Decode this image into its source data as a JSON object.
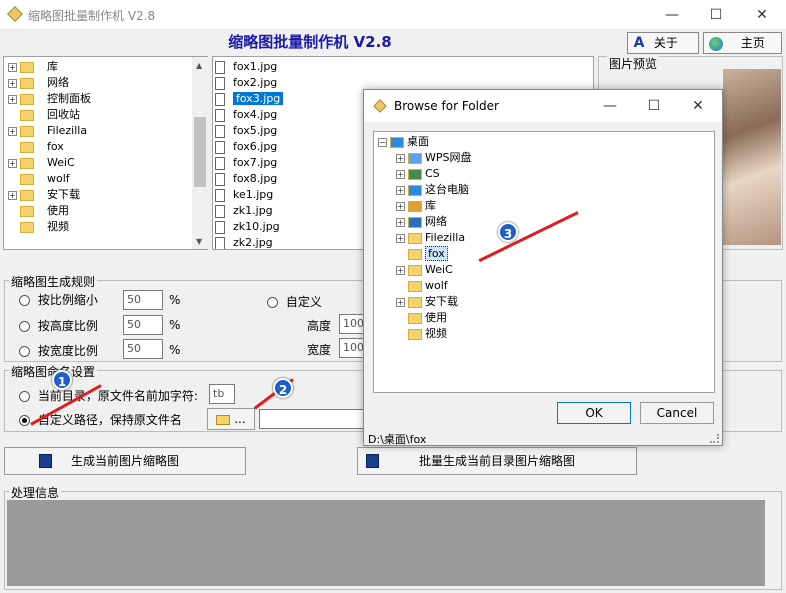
{
  "window": {
    "title": "缩略图批量制作机 V2.8",
    "minimize": "—",
    "maximize": "☐",
    "close": "✕"
  },
  "header": {
    "title": "缩略图批量制作机 V2.8",
    "about_label": "关于",
    "home_label": "主页"
  },
  "folder_tree": [
    {
      "label": "库",
      "expander": "+"
    },
    {
      "label": "网络",
      "expander": "+"
    },
    {
      "label": "控制面板",
      "expander": "+"
    },
    {
      "label": "回收站",
      "expander": ""
    },
    {
      "label": "Filezilla",
      "expander": "+"
    },
    {
      "label": "fox",
      "expander": ""
    },
    {
      "label": "WeiC",
      "expander": "+"
    },
    {
      "label": "wolf",
      "expander": ""
    },
    {
      "label": "安下载",
      "expander": "+"
    },
    {
      "label": "使用",
      "expander": ""
    },
    {
      "label": "视频",
      "expander": ""
    }
  ],
  "file_list": {
    "items": [
      "fox1.jpg",
      "fox2.jpg",
      "fox3.jpg",
      "fox4.jpg",
      "fox5.jpg",
      "fox6.jpg",
      "fox7.jpg",
      "fox8.jpg",
      "ke1.jpg",
      "zk1.jpg",
      "zk10.jpg",
      "zk2.jpg"
    ],
    "selected_index": 2
  },
  "preview": {
    "label": "图片预览"
  },
  "rules": {
    "legend": "缩略图生成规则",
    "options": [
      {
        "label": "按比例缩小",
        "value": "50",
        "unit": "%"
      },
      {
        "label": "按高度比例",
        "value": "50",
        "unit": "%"
      },
      {
        "label": "按宽度比例",
        "value": "50",
        "unit": "%"
      }
    ],
    "custom_label": "自定义",
    "height_label": "高度",
    "height_value": "100",
    "width_label": "宽度",
    "width_value": "100"
  },
  "naming": {
    "legend": "缩略图命名设置",
    "option1_label": "当前目录，原文件名前加字符:",
    "prefix_value": "tb",
    "option2_label": "自定义路径，保持原文件名",
    "browse_label": "...",
    "path_value": ""
  },
  "actions": {
    "generate_current": "生成当前图片缩略图",
    "batch_generate": "批量生成当前目录图片缩略图"
  },
  "log": {
    "legend": "处理信息"
  },
  "dialog": {
    "title": "Browse for Folder",
    "tree": [
      {
        "label": "桌面",
        "expander": "−",
        "level": 0,
        "icon": "monitor-icon"
      },
      {
        "label": "WPS网盘",
        "expander": "+",
        "level": 1,
        "icon": "cloud-icon"
      },
      {
        "label": "CS",
        "expander": "+",
        "level": 1,
        "icon": "user-icon"
      },
      {
        "label": "这台电脑",
        "expander": "+",
        "level": 1,
        "icon": "computer-icon"
      },
      {
        "label": "库",
        "expander": "+",
        "level": 1,
        "icon": "library-icon"
      },
      {
        "label": "网络",
        "expander": "+",
        "level": 1,
        "icon": "network-icon"
      },
      {
        "label": "Filezilla",
        "expander": "+",
        "level": 1,
        "icon": "folder-icon"
      },
      {
        "label": "fox",
        "expander": "",
        "level": 1,
        "icon": "folder-icon"
      },
      {
        "label": "WeiC",
        "expander": "+",
        "level": 1,
        "icon": "folder-icon"
      },
      {
        "label": "wolf",
        "expander": "",
        "level": 1,
        "icon": "folder-icon"
      },
      {
        "label": "安下载",
        "expander": "+",
        "level": 1,
        "icon": "folder-icon"
      },
      {
        "label": "使用",
        "expander": "",
        "level": 1,
        "icon": "folder-icon"
      },
      {
        "label": "视频",
        "expander": "",
        "level": 1,
        "icon": "folder-icon"
      }
    ],
    "selected_index": 7,
    "ok_label": "OK",
    "cancel_label": "Cancel",
    "status_path": "D:\\桌面\\fox"
  },
  "annotations": {
    "badge1": "1",
    "badge2": "2",
    "badge3": "3"
  },
  "colors": {
    "selection": "#0078d7",
    "title_text": "#1a1aa8",
    "arrow": "#e21b1b",
    "badge": "#1e5fc9"
  }
}
